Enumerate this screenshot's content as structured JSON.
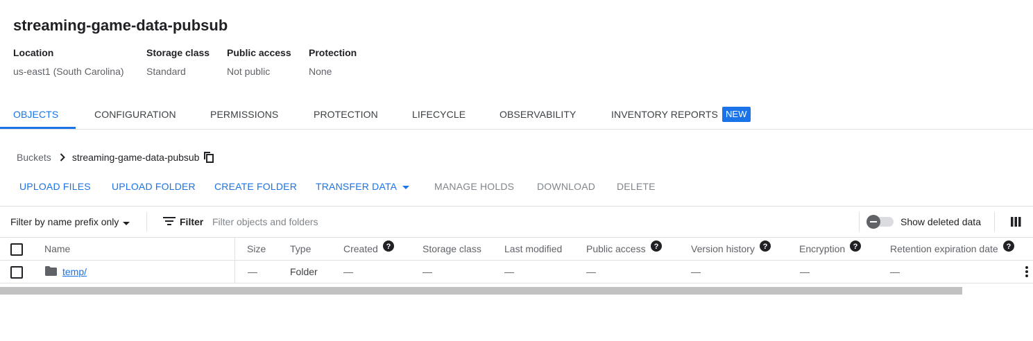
{
  "bucket": {
    "title": "streaming-game-data-pubsub"
  },
  "info": [
    {
      "label": "Location",
      "value": "us-east1 (South Carolina)"
    },
    {
      "label": "Storage class",
      "value": "Standard"
    },
    {
      "label": "Public access",
      "value": "Not public"
    },
    {
      "label": "Protection",
      "value": "None"
    }
  ],
  "tabs": [
    {
      "label": "OBJECTS",
      "active": true
    },
    {
      "label": "CONFIGURATION"
    },
    {
      "label": "PERMISSIONS"
    },
    {
      "label": "PROTECTION"
    },
    {
      "label": "LIFECYCLE"
    },
    {
      "label": "OBSERVABILITY"
    },
    {
      "label": "INVENTORY REPORTS",
      "badge": "NEW"
    }
  ],
  "breadcrumb": {
    "root": "Buckets",
    "current": "streaming-game-data-pubsub"
  },
  "actions": {
    "upload_files": "UPLOAD FILES",
    "upload_folder": "UPLOAD FOLDER",
    "create_folder": "CREATE FOLDER",
    "transfer_data": "TRANSFER DATA",
    "manage_holds": "MANAGE HOLDS",
    "download": "DOWNLOAD",
    "delete": "DELETE"
  },
  "filter": {
    "mode": "Filter by name prefix only",
    "button": "Filter",
    "placeholder": "Filter objects and folders",
    "show_deleted": "Show deleted data",
    "show_deleted_on": false
  },
  "table": {
    "headers": {
      "name": "Name",
      "size": "Size",
      "type": "Type",
      "created": "Created",
      "storage_class": "Storage class",
      "last_modified": "Last modified",
      "public_access": "Public access",
      "version_history": "Version history",
      "encryption": "Encryption",
      "retention": "Retention expiration date"
    },
    "rows": [
      {
        "name": "temp/",
        "size": "—",
        "type": "Folder",
        "created": "—",
        "storage_class": "—",
        "last_modified": "—",
        "public_access": "—",
        "version_history": "—",
        "encryption": "—",
        "retention": "—"
      }
    ]
  },
  "colors": {
    "accent": "#1a73e8",
    "text": "#202124",
    "muted": "#5f6368",
    "disabled": "#80868b",
    "divider": "#e0e0e0"
  }
}
